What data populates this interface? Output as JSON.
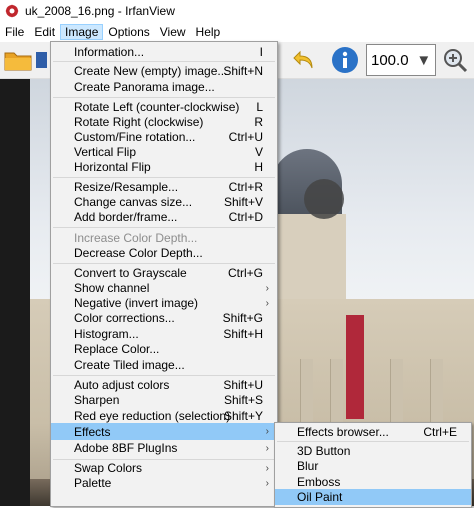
{
  "window": {
    "title": "uk_2008_16.png - IrfanView"
  },
  "menubar": {
    "items": [
      {
        "label": "File"
      },
      {
        "label": "Edit"
      },
      {
        "label": "Image"
      },
      {
        "label": "Options"
      },
      {
        "label": "View"
      },
      {
        "label": "Help"
      }
    ]
  },
  "toolbar": {
    "zoom_value": "100.0"
  },
  "image_menu": {
    "items": [
      {
        "label": "Information...",
        "shortcut": "I"
      },
      {
        "label": "Create New (empty) image...",
        "shortcut": "Shift+N"
      },
      {
        "label": "Create Panorama image...",
        "shortcut": ""
      },
      {
        "label": "Rotate Left (counter-clockwise)",
        "shortcut": "L"
      },
      {
        "label": "Rotate Right (clockwise)",
        "shortcut": "R"
      },
      {
        "label": "Custom/Fine rotation...",
        "shortcut": "Ctrl+U"
      },
      {
        "label": "Vertical Flip",
        "shortcut": "V"
      },
      {
        "label": "Horizontal Flip",
        "shortcut": "H"
      },
      {
        "label": "Resize/Resample...",
        "shortcut": "Ctrl+R"
      },
      {
        "label": "Change canvas size...",
        "shortcut": "Shift+V"
      },
      {
        "label": "Add border/frame...",
        "shortcut": "Ctrl+D"
      },
      {
        "label": "Increase Color Depth...",
        "shortcut": ""
      },
      {
        "label": "Decrease Color Depth...",
        "shortcut": ""
      },
      {
        "label": "Convert to Grayscale",
        "shortcut": "Ctrl+G"
      },
      {
        "label": "Show channel",
        "shortcut": ""
      },
      {
        "label": "Negative (invert image)",
        "shortcut": ""
      },
      {
        "label": "Color corrections...",
        "shortcut": "Shift+G"
      },
      {
        "label": "Histogram...",
        "shortcut": "Shift+H"
      },
      {
        "label": "Replace Color...",
        "shortcut": ""
      },
      {
        "label": "Create Tiled image...",
        "shortcut": ""
      },
      {
        "label": "Auto adjust colors",
        "shortcut": "Shift+U"
      },
      {
        "label": "Sharpen",
        "shortcut": "Shift+S"
      },
      {
        "label": "Red eye reduction (selection)",
        "shortcut": "Shift+Y"
      },
      {
        "label": "Effects",
        "shortcut": ""
      },
      {
        "label": "Adobe 8BF PlugIns",
        "shortcut": ""
      },
      {
        "label": "Swap Colors",
        "shortcut": ""
      },
      {
        "label": "Palette",
        "shortcut": ""
      }
    ]
  },
  "effects_submenu": {
    "items": [
      {
        "label": "Effects browser...",
        "shortcut": "Ctrl+E"
      },
      {
        "label": "3D Button",
        "shortcut": ""
      },
      {
        "label": "Blur",
        "shortcut": ""
      },
      {
        "label": "Emboss",
        "shortcut": ""
      },
      {
        "label": "Oil Paint",
        "shortcut": ""
      }
    ]
  },
  "colors": {
    "menu_highlight": "#91c9f7",
    "menubar_active": "#cce8ff",
    "disabled_text": "#8d8d8d"
  }
}
